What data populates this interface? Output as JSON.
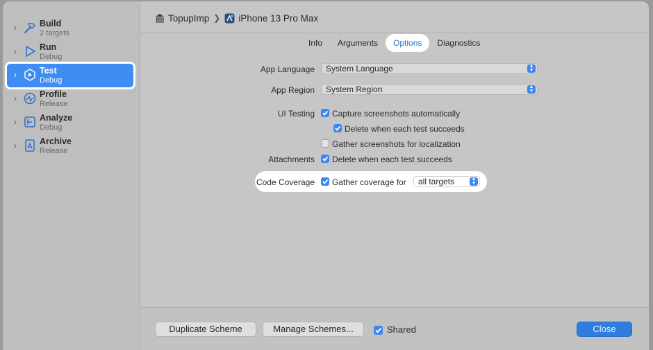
{
  "sidebar": {
    "items": [
      {
        "name": "Build",
        "sub": "2 targets",
        "icon": "hammer-icon"
      },
      {
        "name": "Run",
        "sub": "Debug",
        "icon": "play-icon"
      },
      {
        "name": "Test",
        "sub": "Debug",
        "icon": "test-play-icon"
      },
      {
        "name": "Profile",
        "sub": "Release",
        "icon": "gauge-icon"
      },
      {
        "name": "Analyze",
        "sub": "Debug",
        "icon": "analyze-icon"
      },
      {
        "name": "Archive",
        "sub": "Release",
        "icon": "archive-icon"
      }
    ],
    "selected_index": 2
  },
  "header": {
    "project": "TopupImp",
    "separator": "❯",
    "device": "iPhone 13 Pro Max"
  },
  "tabs": [
    {
      "label": "Info"
    },
    {
      "label": "Arguments"
    },
    {
      "label": "Options",
      "active": true
    },
    {
      "label": "Diagnostics"
    }
  ],
  "form": {
    "app_language": {
      "label": "App Language",
      "value": "System Language"
    },
    "app_region": {
      "label": "App Region",
      "value": "System Region"
    },
    "ui_testing": {
      "label": "UI Testing",
      "capture": {
        "text": "Capture screenshots automatically",
        "checked": true
      },
      "delete_success": {
        "text": "Delete when each test succeeds",
        "checked": true
      },
      "localization": {
        "text": "Gather screenshots for localization",
        "checked": false
      }
    },
    "attachments": {
      "label": "Attachments",
      "delete_success": {
        "text": "Delete when each test succeeds",
        "checked": true
      }
    },
    "code_coverage": {
      "label": "Code Coverage",
      "gather": {
        "text": "Gather coverage for",
        "checked": true
      },
      "targets_value": "all targets"
    }
  },
  "footer": {
    "duplicate": "Duplicate Scheme",
    "manage": "Manage Schemes...",
    "shared": {
      "text": "Shared",
      "checked": true
    },
    "close": "Close"
  },
  "colors": {
    "accent": "#3d86f0",
    "selection": "#3d8df2",
    "close_button": "#2f7de0"
  }
}
